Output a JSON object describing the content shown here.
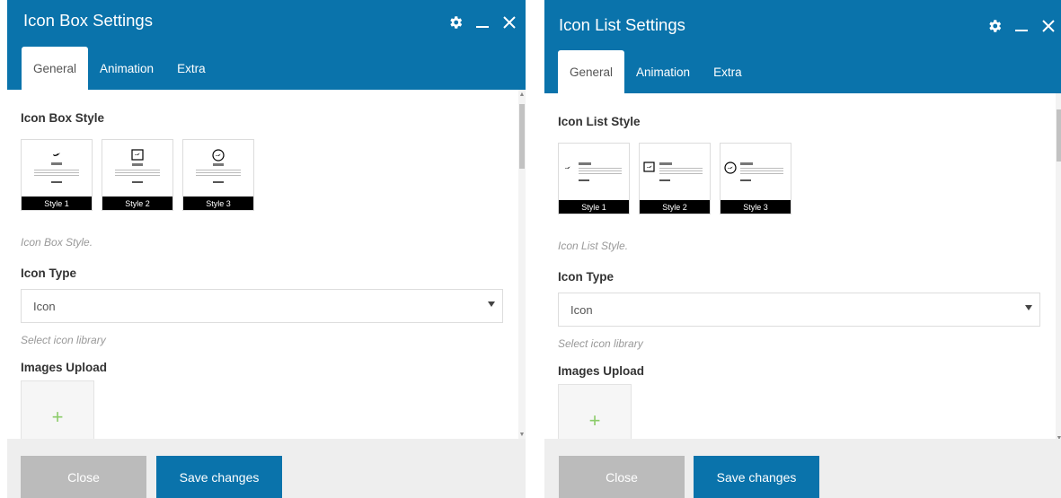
{
  "panels": [
    {
      "title": "Icon Box Settings",
      "tabs": [
        "General",
        "Animation",
        "Extra"
      ],
      "style_label": "Icon Box Style",
      "style_options": [
        "Style 1",
        "Style 2",
        "Style 3"
      ],
      "style_desc": "Icon Box Style.",
      "icon_type_label": "Icon Type",
      "icon_type_value": "Icon",
      "icon_type_desc": "Select icon library",
      "images_label": "Images Upload",
      "upload_symbol": "+",
      "close_label": "Close",
      "save_label": "Save changes"
    },
    {
      "title": "Icon List Settings",
      "tabs": [
        "General",
        "Animation",
        "Extra"
      ],
      "style_label": "Icon List Style",
      "style_options": [
        "Style 1",
        "Style 2",
        "Style 3"
      ],
      "style_desc": "Icon List Style.",
      "icon_type_label": "Icon Type",
      "icon_type_value": "Icon",
      "icon_type_desc": "Select icon library",
      "images_label": "Images Upload",
      "upload_symbol": "+",
      "close_label": "Close",
      "save_label": "Save changes"
    }
  ],
  "icons": {
    "settings": "gear-icon",
    "minimize": "minimize-icon",
    "close": "close-icon",
    "dropdown": "chevron-down-icon",
    "twitter": "twitter-bird-icon"
  },
  "colors": {
    "header": "#0a73ab",
    "save_button": "#0a73ab",
    "close_button": "#bbbbbb",
    "footer": "#eeeeee",
    "upload_plus": "#8ccc6a"
  }
}
